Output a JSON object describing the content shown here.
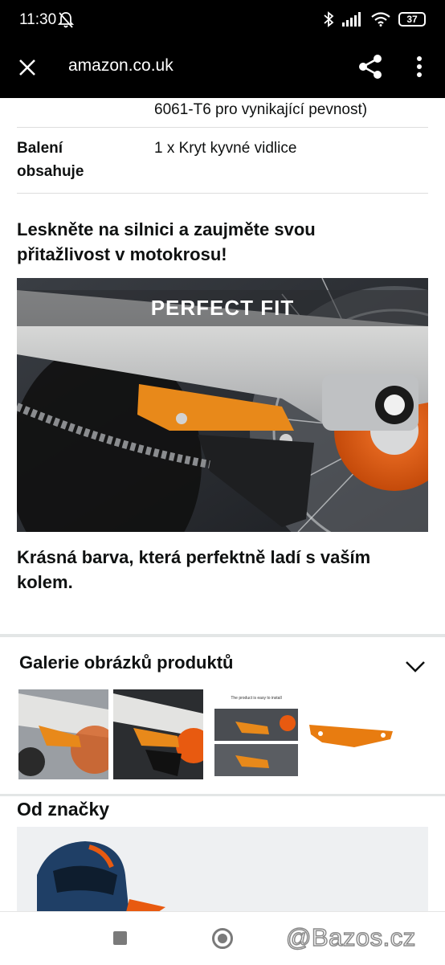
{
  "status": {
    "time": "11:30",
    "battery": "37"
  },
  "browser": {
    "url": "amazon.co.uk"
  },
  "specs": {
    "partial_value": "6061-T6 pro vynikající pevnost)",
    "row_key_line1": "Balení",
    "row_key_line2": "obsahuje",
    "row_value": "1 x Kryt kyvné vidlice"
  },
  "sections": {
    "heading1_line1": "Lesknětе na silnici a zaujměte svou",
    "heading1_line2": "přitažlivost v motokrosu!",
    "hero_overlay": "PERFECT FIT",
    "heading2_line1": "Krásná barva, která perfektně ladí s vaším",
    "heading2_line2": "kolem."
  },
  "gallery": {
    "title": "Galerie obrázků produktů",
    "thumb3_caption": "The product is easy to install"
  },
  "brand": {
    "title": "Od značky"
  },
  "watermark": "@Bazos.cz",
  "colors": {
    "orange": "#e8891a",
    "ktm_orange": "#e85a10",
    "bar": "#000000"
  }
}
